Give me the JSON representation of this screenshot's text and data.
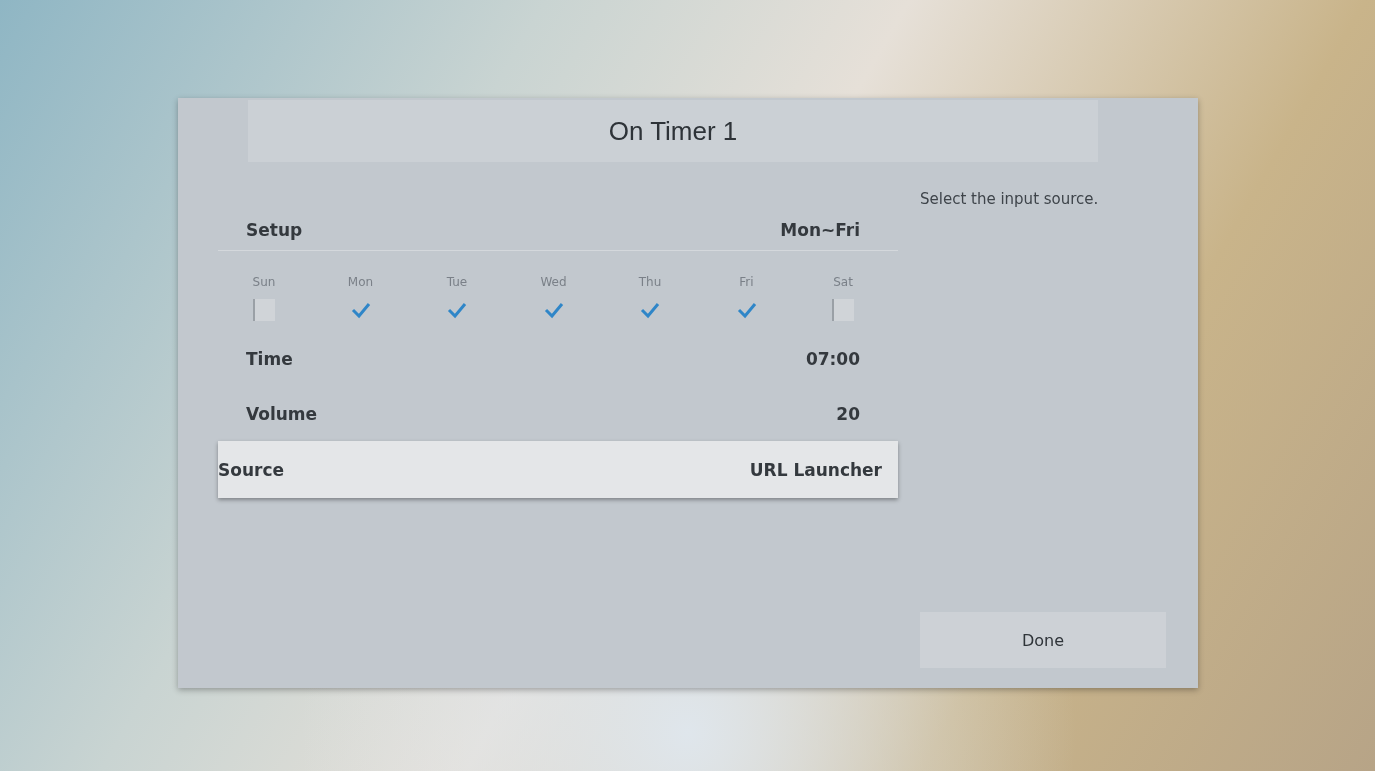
{
  "dialog": {
    "title": "On Timer 1"
  },
  "setup": {
    "label": "Setup",
    "value": "Mon~Fri"
  },
  "days": [
    {
      "label": "Sun",
      "checked": false
    },
    {
      "label": "Mon",
      "checked": true
    },
    {
      "label": "Tue",
      "checked": true
    },
    {
      "label": "Wed",
      "checked": true
    },
    {
      "label": "Thu",
      "checked": true
    },
    {
      "label": "Fri",
      "checked": true
    },
    {
      "label": "Sat",
      "checked": false
    }
  ],
  "settings": [
    {
      "label": "Time",
      "value": "07:00",
      "selected": false
    },
    {
      "label": "Volume",
      "value": "20",
      "selected": false
    },
    {
      "label": "Source",
      "value": "URL Launcher",
      "selected": true
    }
  ],
  "help_text": "Select the input source.",
  "done_button": "Done"
}
